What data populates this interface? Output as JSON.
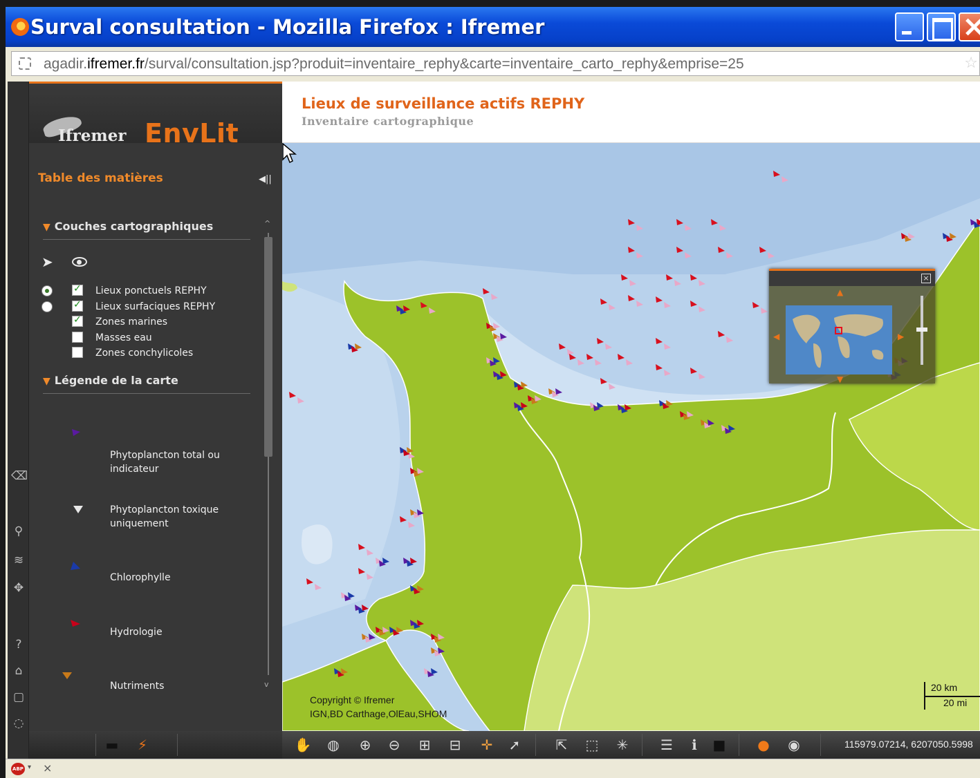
{
  "window": {
    "title": "Surval consultation - Mozilla Firefox : Ifremer",
    "url_prefix": "agadir.",
    "url_host": "ifremer.fr",
    "url_path": "/surval/consultation.jsp?produit=inventaire_rephy&carte=inventaire_carto_rephy&emprise=25"
  },
  "sidebar": {
    "logo_text": "Ifremer",
    "app_name": "EnvLit",
    "toc_title": "Table des matières",
    "sections": {
      "layers_title": "Couches cartographiques",
      "legend_title": "Légende de la carte"
    },
    "layers": [
      {
        "label": "Lieux ponctuels REPHY",
        "radio": true,
        "checked": true
      },
      {
        "label": "Lieux surfaciques REPHY",
        "radio": false,
        "checked": true
      },
      {
        "label": "Zones marines",
        "checked": true
      },
      {
        "label": "Masses eau",
        "checked": false
      },
      {
        "label": "Zones conchylicoles",
        "checked": false
      }
    ],
    "legend": [
      {
        "label": "Phytoplancton total ou indicateur",
        "color": "#5a1aa0"
      },
      {
        "label": "Phytoplancton toxique uniquement",
        "color": "#e8e8e8"
      },
      {
        "label": "Chlorophylle",
        "color": "#1a3aa8"
      },
      {
        "label": "Hydrologie",
        "color": "#c8001a"
      },
      {
        "label": "Nutriments",
        "color": "#c87a1a"
      }
    ]
  },
  "map": {
    "title": "Lieux de surveillance actifs REPHY",
    "subtitle": "Inventaire cartographique",
    "copyright_line1": "Copyright © Ifremer",
    "copyright_line2": "IGN,BD Carthage,OlEau,SHOM",
    "scale_km": "20 km",
    "scale_mi": "20 mi",
    "coordinates": "115979.07214, 6207050.5998",
    "colors": {
      "sea_light": "#c8dcf0",
      "sea_deep": "#9fc0e4",
      "land_green": "#9cc22a",
      "land_light": "#cfe37a",
      "marker_red": "#d8101e",
      "marker_pink": "#e8a8c8"
    }
  },
  "toolbar": {
    "icons": [
      "pan-hand-icon",
      "globe-extent-icon",
      "zoom-in-icon",
      "zoom-out-icon",
      "zoom-box-in-icon",
      "zoom-box-out-icon",
      "center-icon",
      "select-icon",
      "select-tool-icon",
      "select-rect-icon",
      "select-point-icon",
      "list-icon",
      "info-icon",
      "layer-icon",
      "world-map-icon",
      "globe-icon"
    ]
  },
  "statusbar": {
    "addon_label": "ABP"
  }
}
